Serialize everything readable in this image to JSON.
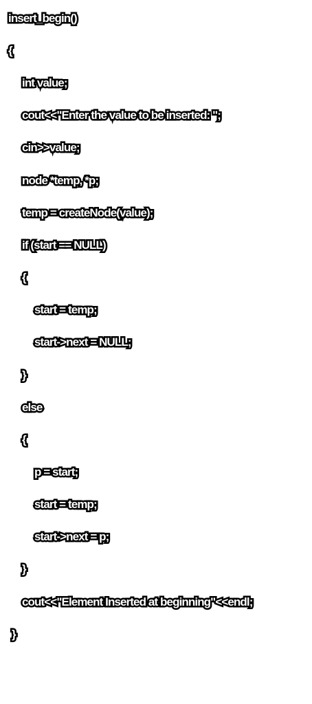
{
  "code": {
    "lines": [
      "insert_begin()",
      "{",
      "int value;",
      "cout<<\"Enter the value to be inserted: \";",
      "cin>>value;",
      "node *temp, *p;",
      "temp = createNode(value);",
      "if (start == NULL)",
      "{",
      "start = temp;",
      "start->next = NULL;",
      "}",
      "else",
      "{",
      "p = start;",
      "start = temp;",
      "start->next = p;",
      "}",
      "cout<<\"Element Inserted at beginning\"<<endl;",
      "}"
    ]
  }
}
